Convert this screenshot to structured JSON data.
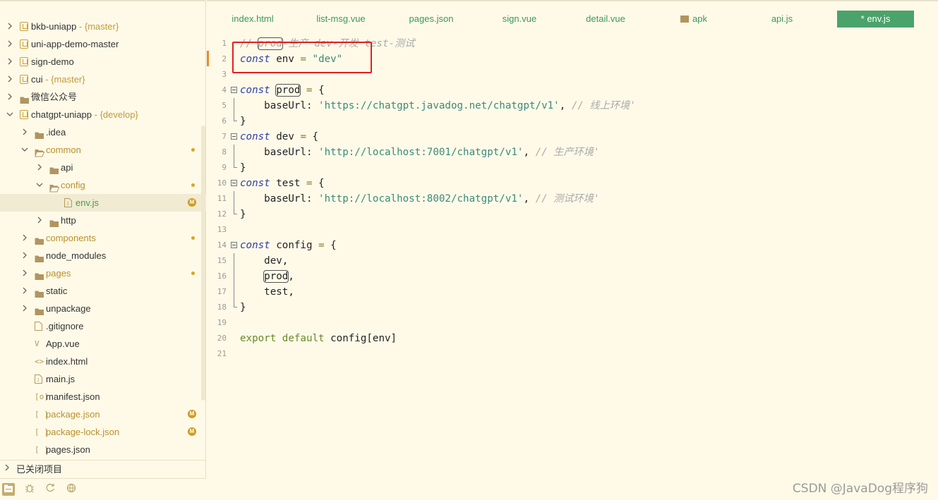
{
  "sidebar": {
    "tree": [
      {
        "label": "bkb-uniapp",
        "branch": " - {master}",
        "type": "project",
        "depth": 0,
        "expanded": false
      },
      {
        "label": "uni-app-demo-master",
        "type": "project",
        "depth": 0,
        "expanded": false
      },
      {
        "label": "sign-demo",
        "type": "project",
        "depth": 0,
        "expanded": false
      },
      {
        "label": "cui",
        "branch": " - {master}",
        "type": "project",
        "depth": 0,
        "expanded": false
      },
      {
        "label": "微信公众号",
        "type": "folder",
        "depth": 0,
        "expanded": false
      },
      {
        "label": "chatgpt-uniapp",
        "branch": " - {develop}",
        "type": "project",
        "depth": 0,
        "expanded": true
      },
      {
        "label": ".idea",
        "type": "folder",
        "depth": 1,
        "expanded": false
      },
      {
        "label": "common",
        "type": "folder",
        "depth": 1,
        "expanded": true,
        "modified": true,
        "badge": "dot"
      },
      {
        "label": "api",
        "type": "folder",
        "depth": 2,
        "expanded": false
      },
      {
        "label": "config",
        "type": "folder",
        "depth": 2,
        "expanded": true,
        "modified": true,
        "badge": "dot"
      },
      {
        "label": "env.js",
        "type": "js",
        "depth": 3,
        "selected": true,
        "active": true,
        "badge": "M"
      },
      {
        "label": "http",
        "type": "folder",
        "depth": 2,
        "expanded": false
      },
      {
        "label": "components",
        "type": "folder",
        "depth": 1,
        "expanded": false,
        "modified": true,
        "badge": "dot"
      },
      {
        "label": "node_modules",
        "type": "folder",
        "depth": 1,
        "expanded": false
      },
      {
        "label": "pages",
        "type": "folder",
        "depth": 1,
        "expanded": false,
        "modified": true,
        "badge": "dot"
      },
      {
        "label": "static",
        "type": "folder",
        "depth": 1,
        "expanded": false
      },
      {
        "label": "unpackage",
        "type": "folder",
        "depth": 1,
        "expanded": false
      },
      {
        "label": ".gitignore",
        "type": "file",
        "depth": 1
      },
      {
        "label": "App.vue",
        "type": "vue",
        "depth": 1
      },
      {
        "label": "index.html",
        "type": "html",
        "depth": 1
      },
      {
        "label": "main.js",
        "type": "js",
        "depth": 1
      },
      {
        "label": "manifest.json",
        "type": "manifest",
        "depth": 1
      },
      {
        "label": "package.json",
        "type": "json",
        "depth": 1,
        "modified": true,
        "badge": "M"
      },
      {
        "label": "package-lock.json",
        "type": "json",
        "depth": 1,
        "modified": true,
        "badge": "M"
      },
      {
        "label": "pages.json",
        "type": "json",
        "depth": 1
      }
    ],
    "closed_projects_label": "已关闭项目"
  },
  "tabs": [
    {
      "label": "index.html"
    },
    {
      "label": "list-msg.vue"
    },
    {
      "label": "pages.json"
    },
    {
      "label": "sign.vue"
    },
    {
      "label": "detail.vue"
    },
    {
      "label": "apk",
      "folder": true
    },
    {
      "label": "api.js"
    },
    {
      "label": "* env.js",
      "active": true
    }
  ],
  "code": {
    "line_numbers": [
      "1",
      "2",
      "3",
      "4",
      "5",
      "6",
      "7",
      "8",
      "9",
      "10",
      "11",
      "12",
      "13",
      "14",
      "15",
      "16",
      "17",
      "18",
      "19",
      "20",
      "21"
    ],
    "lines": [
      [
        {
          "t": "// ",
          "c": "cm"
        },
        {
          "t": "prod",
          "c": "cm boxed"
        },
        {
          "t": "-生产 dev-开发 test-测试",
          "c": "cm"
        }
      ],
      [
        {
          "t": "const",
          "c": "kw"
        },
        {
          "t": " env ",
          "c": ""
        },
        {
          "t": "=",
          "c": "kw2"
        },
        {
          "t": " ",
          "c": ""
        },
        {
          "t": "\"dev\"",
          "c": "str"
        }
      ],
      [],
      [
        {
          "t": "const",
          "c": "kw"
        },
        {
          "t": " ",
          "c": ""
        },
        {
          "t": "prod",
          "c": "boxed"
        },
        {
          "t": " ",
          "c": ""
        },
        {
          "t": "=",
          "c": "kw2"
        },
        {
          "t": " {",
          "c": ""
        }
      ],
      [
        {
          "t": "    baseUrl: ",
          "c": ""
        },
        {
          "t": "'https://chatgpt.javadog.net/chatgpt/v1'",
          "c": "str"
        },
        {
          "t": ", ",
          "c": ""
        },
        {
          "t": "// 线上环境'",
          "c": "cm"
        }
      ],
      [
        {
          "t": "}",
          "c": ""
        }
      ],
      [
        {
          "t": "const",
          "c": "kw"
        },
        {
          "t": " dev ",
          "c": ""
        },
        {
          "t": "=",
          "c": "kw2"
        },
        {
          "t": " {",
          "c": ""
        }
      ],
      [
        {
          "t": "    baseUrl: ",
          "c": ""
        },
        {
          "t": "'http://localhost:7001/chatgpt/v1'",
          "c": "str"
        },
        {
          "t": ", ",
          "c": ""
        },
        {
          "t": "// 生产环境'",
          "c": "cm"
        }
      ],
      [
        {
          "t": "}",
          "c": ""
        }
      ],
      [
        {
          "t": "const",
          "c": "kw"
        },
        {
          "t": " test ",
          "c": ""
        },
        {
          "t": "=",
          "c": "kw2"
        },
        {
          "t": " {",
          "c": ""
        }
      ],
      [
        {
          "t": "    baseUrl: ",
          "c": ""
        },
        {
          "t": "'http://localhost:8002/chatgpt/v1'",
          "c": "str"
        },
        {
          "t": ", ",
          "c": ""
        },
        {
          "t": "// 测试环境'",
          "c": "cm"
        }
      ],
      [
        {
          "t": "}",
          "c": ""
        }
      ],
      [],
      [
        {
          "t": "const",
          "c": "kw"
        },
        {
          "t": " config ",
          "c": ""
        },
        {
          "t": "=",
          "c": "kw2"
        },
        {
          "t": " {",
          "c": ""
        }
      ],
      [
        {
          "t": "    dev,",
          "c": ""
        }
      ],
      [
        {
          "t": "    ",
          "c": ""
        },
        {
          "t": "prod",
          "c": "boxed"
        },
        {
          "t": ",",
          "c": ""
        }
      ],
      [
        {
          "t": "    test,",
          "c": ""
        }
      ],
      [
        {
          "t": "}",
          "c": ""
        }
      ],
      [],
      [
        {
          "t": "export",
          "c": "kw2"
        },
        {
          "t": " ",
          "c": ""
        },
        {
          "t": "default",
          "c": "kw2"
        },
        {
          "t": " config[env]",
          "c": ""
        }
      ],
      []
    ],
    "fold_open_lines": [
      4,
      7,
      10,
      14
    ],
    "fold_end_lines": [
      6,
      9,
      12,
      18
    ],
    "fold_mid_lines": [
      5,
      8,
      11,
      15,
      16,
      17
    ],
    "modified_line": 2
  },
  "watermark": "CSDN @JavaDog程序狗"
}
